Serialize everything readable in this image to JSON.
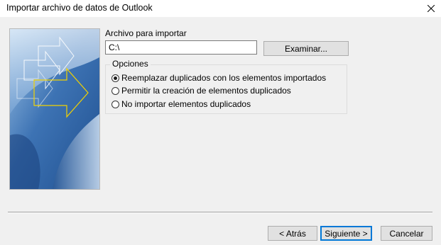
{
  "window": {
    "title": "Importar archivo de datos de Outlook",
    "close_icon": "close-icon"
  },
  "file": {
    "label": "Archivo para importar",
    "path_value": "C:\\",
    "browse_label": "Examinar..."
  },
  "options": {
    "legend": "Opciones",
    "items": [
      {
        "label": "Reemplazar duplicados con los elementos importados",
        "selected": true
      },
      {
        "label": "Permitir la creación de elementos duplicados",
        "selected": false
      },
      {
        "label": "No importar elementos duplicados",
        "selected": false
      }
    ]
  },
  "footer": {
    "back_label": "< Atrás",
    "next_label": "Siguiente >",
    "cancel_label": "Cancelar"
  },
  "colors": {
    "dialog_bg": "#f0f0f0",
    "art_blue": "#2f5f9c",
    "arrow_yellow": "#f2d200",
    "focus_blue": "#0078d7"
  }
}
